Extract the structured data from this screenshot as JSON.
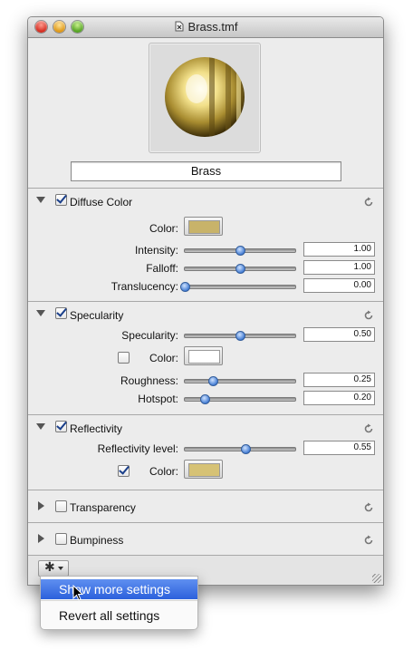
{
  "window": {
    "title": "Brass.tmf"
  },
  "preview": {
    "name_value": "Brass"
  },
  "sections": {
    "diffuse": {
      "label": "Diffuse Color",
      "checked": true,
      "expanded": true,
      "color_label": "Color:",
      "color_hex": "#c8b36a",
      "intensity": {
        "label": "Intensity:",
        "value": "1.00",
        "level": 0.5
      },
      "falloff": {
        "label": "Falloff:",
        "value": "1.00",
        "level": 0.5
      },
      "translucency": {
        "label": "Translucency:",
        "value": "0.00",
        "level": 0.0
      }
    },
    "specularity": {
      "label": "Specularity",
      "checked": true,
      "expanded": true,
      "specularity": {
        "label": "Specularity:",
        "value": "0.50",
        "level": 0.5
      },
      "color_label": "Color:",
      "color_checked": false,
      "color_hex": "#ffffff",
      "roughness": {
        "label": "Roughness:",
        "value": "0.25",
        "level": 0.25
      },
      "hotspot": {
        "label": "Hotspot:",
        "value": "0.20",
        "level": 0.18
      }
    },
    "reflectivity": {
      "label": "Reflectivity",
      "checked": true,
      "expanded": true,
      "level_row": {
        "label": "Reflectivity level:",
        "value": "0.55",
        "level": 0.55
      },
      "color_label": "Color:",
      "color_checked": true,
      "color_hex": "#d6c275"
    },
    "transparency": {
      "label": "Transparency",
      "checked": false,
      "expanded": false
    },
    "bumpiness": {
      "label": "Bumpiness",
      "checked": false,
      "expanded": false
    }
  },
  "menu": {
    "items": [
      {
        "label": "Show more settings",
        "highlighted": true
      },
      {
        "label": "Revert all settings",
        "highlighted": false
      }
    ]
  },
  "icons": {
    "reset": "reset-icon",
    "gear": "gear-icon",
    "document": "document-icon"
  }
}
